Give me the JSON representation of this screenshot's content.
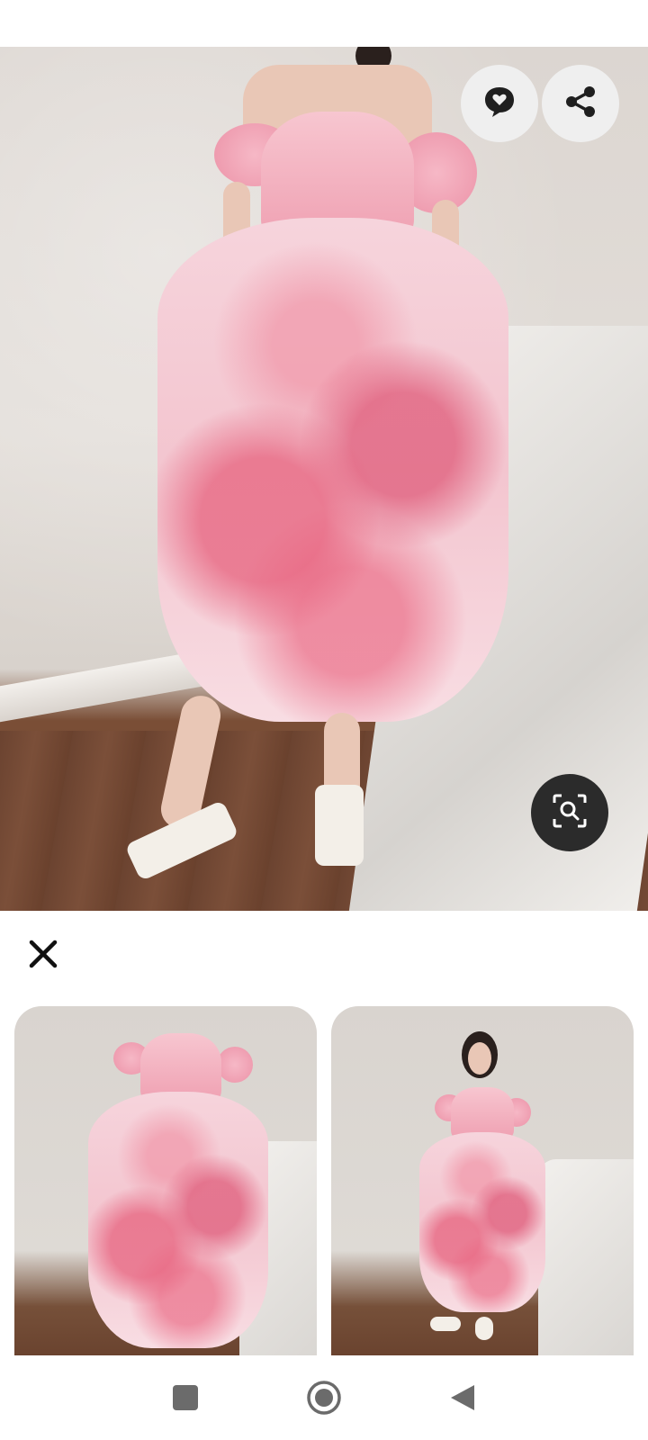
{
  "main_image": {
    "comment_button_icon": "comment-heart-icon",
    "share_button_icon": "share-icon",
    "visual_search_button_icon": "visual-search-icon"
  },
  "sheet": {
    "close_icon": "close-icon",
    "related_pins": [
      {
        "icon": "dress-photo-closeup"
      },
      {
        "icon": "dress-photo-full"
      }
    ]
  },
  "nav_bar": {
    "recents_icon": "square-icon",
    "home_icon": "circle-icon",
    "back_icon": "triangle-back-icon"
  },
  "colors": {
    "accent_dark": "#2b2b2b",
    "button_light": "#efefef",
    "dress_pink": "#ec93a8"
  }
}
